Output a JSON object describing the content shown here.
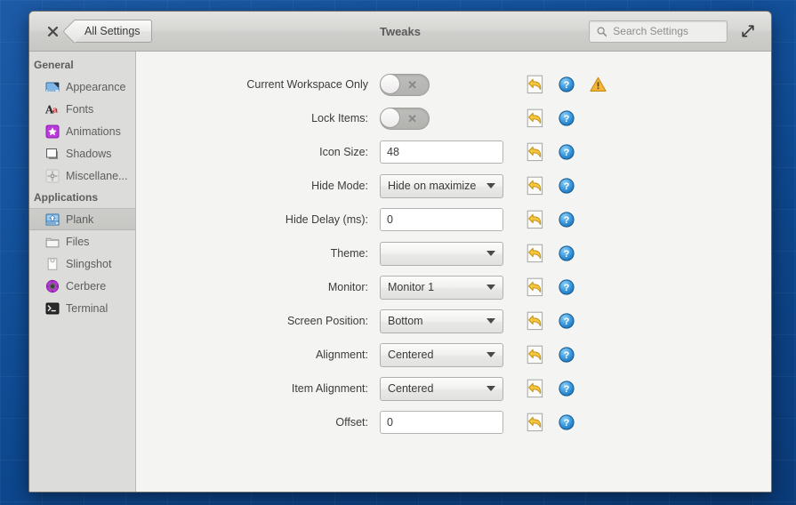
{
  "window": {
    "title": "Tweaks",
    "close_label": "×",
    "back_button": "All Settings",
    "maximize_label": "maximize"
  },
  "search": {
    "placeholder": "Search Settings",
    "value": ""
  },
  "sidebar": {
    "groups": [
      {
        "header": "General",
        "items": [
          {
            "label": "Appearance",
            "icon": "appearance-icon",
            "selected": false
          },
          {
            "label": "Fonts",
            "icon": "fonts-icon",
            "selected": false
          },
          {
            "label": "Animations",
            "icon": "animations-icon",
            "selected": false
          },
          {
            "label": "Shadows",
            "icon": "shadows-icon",
            "selected": false
          },
          {
            "label": "Miscellane...",
            "icon": "miscellaneous-icon",
            "selected": false
          }
        ]
      },
      {
        "header": "Applications",
        "items": [
          {
            "label": "Plank",
            "icon": "plank-icon",
            "selected": true
          },
          {
            "label": "Files",
            "icon": "files-icon",
            "selected": false
          },
          {
            "label": "Slingshot",
            "icon": "slingshot-icon",
            "selected": false
          },
          {
            "label": "Cerbere",
            "icon": "cerbere-icon",
            "selected": false
          },
          {
            "label": "Terminal",
            "icon": "terminal-icon",
            "selected": false
          }
        ]
      }
    ]
  },
  "settings": {
    "rows": [
      {
        "label": "Current Workspace Only",
        "type": "switch",
        "value": "off",
        "off_mark": "✕",
        "reset": true,
        "help": true,
        "warning": true
      },
      {
        "label": "Lock Items:",
        "type": "switch",
        "value": "off",
        "off_mark": "✕",
        "reset": true,
        "help": true,
        "warning": false
      },
      {
        "label": "Icon Size:",
        "type": "spinner",
        "value": "48",
        "minus": "−",
        "plus": "+",
        "reset": true,
        "help": true,
        "warning": false
      },
      {
        "label": "Hide Mode:",
        "type": "combo",
        "value": "Hide on maximize",
        "reset": true,
        "help": true,
        "warning": false
      },
      {
        "label": "Hide Delay (ms):",
        "type": "spinner",
        "value": "0",
        "minus": "−",
        "plus": "+",
        "reset": true,
        "help": true,
        "warning": false
      },
      {
        "label": "Theme:",
        "type": "combo",
        "value": "",
        "reset": true,
        "help": true,
        "warning": false
      },
      {
        "label": "Monitor:",
        "type": "combo",
        "value": "Monitor 1",
        "reset": true,
        "help": true,
        "warning": false
      },
      {
        "label": "Screen Position:",
        "type": "combo",
        "value": "Bottom",
        "reset": true,
        "help": true,
        "warning": false
      },
      {
        "label": "Alignment:",
        "type": "combo",
        "value": "Centered",
        "reset": true,
        "help": true,
        "warning": false
      },
      {
        "label": "Item Alignment:",
        "type": "combo",
        "value": "Centered",
        "reset": true,
        "help": true,
        "warning": false
      },
      {
        "label": "Offset:",
        "type": "spinner",
        "value": "0",
        "minus": "−",
        "plus": "+",
        "reset": true,
        "help": true,
        "warning": false
      }
    ]
  },
  "colors": {
    "desktop_blue": "#14539f",
    "titlebar_grey": "#d6d6d3",
    "sidebar_grey": "#dcdcda",
    "panel_grey": "#f4f4f2",
    "help_blue": "#2e8fd8",
    "warning_orange": "#f0ad2e",
    "reset_arrow_yellow": "#f2c02c"
  }
}
